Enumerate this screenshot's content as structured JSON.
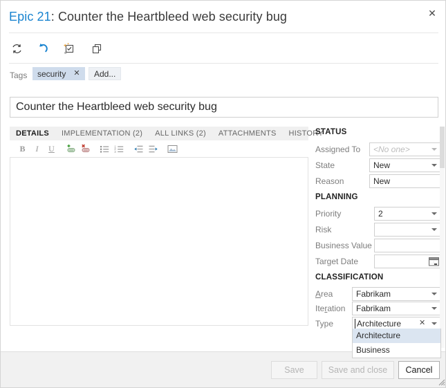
{
  "window": {
    "title_id": "Epic 21",
    "title_rest": ": Counter the Heartbleed web security bug",
    "close_label": "✕"
  },
  "toolbar": {
    "refresh_tooltip": "Refresh",
    "undo_tooltip": "Undo",
    "new_tooltip": "New linked work item",
    "copy_tooltip": "Copy"
  },
  "tags": {
    "label": "Tags",
    "chips": [
      {
        "text": "security",
        "remove": "✕"
      }
    ],
    "add_label": "Add..."
  },
  "title_field": {
    "value": "Counter the Heartbleed web security bug"
  },
  "tabs": [
    {
      "label": "DETAILS",
      "active": true
    },
    {
      "label": "IMPLEMENTATION (2)",
      "active": false
    },
    {
      "label": "ALL LINKS (2)",
      "active": false
    },
    {
      "label": "ATTACHMENTS",
      "active": false
    },
    {
      "label": "HISTORY",
      "active": false
    }
  ],
  "format_toolbar": [
    {
      "name": "bold-icon",
      "glyph": "B"
    },
    {
      "name": "italic-icon",
      "glyph": "I"
    },
    {
      "name": "underline-icon",
      "glyph": "U"
    },
    {
      "name": "insert-link-icon",
      "glyph": ""
    },
    {
      "name": "remove-link-icon",
      "glyph": ""
    },
    {
      "name": "bulleted-list-icon",
      "glyph": ""
    },
    {
      "name": "numbered-list-icon",
      "glyph": ""
    },
    {
      "name": "outdent-icon",
      "glyph": ""
    },
    {
      "name": "indent-icon",
      "glyph": ""
    },
    {
      "name": "insert-image-icon",
      "glyph": ""
    }
  ],
  "description": {
    "value": ""
  },
  "panel": {
    "status": {
      "heading": "STATUS",
      "assigned_to_label": "Assigned To",
      "assigned_to_value": "<No one>",
      "state_label": "State",
      "state_accesskey": "t",
      "state_value": "New",
      "reason_label": "Reason",
      "reason_value": "New"
    },
    "planning": {
      "heading": "PLANNING",
      "priority_label": "Priority",
      "priority_value": "2",
      "risk_label": "Risk",
      "risk_value": "",
      "business_value_label": "Business Value",
      "business_value_value": "",
      "target_date_label": "Target Date",
      "target_date_value": ""
    },
    "classification": {
      "heading": "CLASSIFICATION",
      "area_label": "Area",
      "area_accesskey": "A",
      "area_value": "Fabrikam",
      "iteration_label": "Iteration",
      "iteration_accesskey": "r",
      "iteration_value": "Fabrikam",
      "type_label": "Type",
      "type_value": "Architecture",
      "type_clear": "✕"
    }
  },
  "type_dropdown": {
    "options": [
      {
        "label": "Architecture",
        "selected": true
      },
      {
        "label": "Business",
        "selected": false
      }
    ]
  },
  "footer": {
    "save_label": "Save",
    "save_enabled": false,
    "save_close_label": "Save and close",
    "save_close_enabled": false,
    "cancel_label": "Cancel",
    "cancel_enabled": true
  },
  "colors": {
    "accent_link": "#1a84d0",
    "tag_chip_bg": "#cfdcec",
    "dropdown_selected_bg": "#dbe5f1",
    "tabstrip_bg": "#f0f0f0",
    "footer_bg": "#f1f1f1"
  }
}
